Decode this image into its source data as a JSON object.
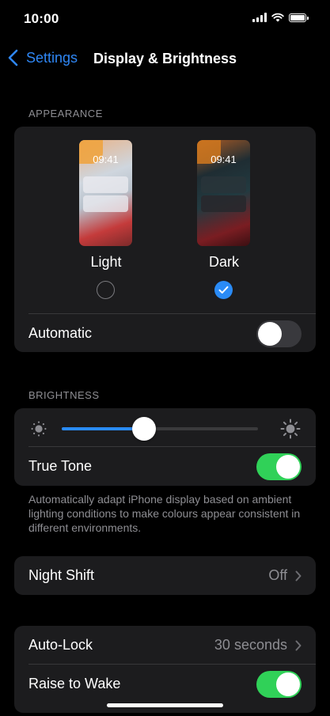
{
  "status_bar": {
    "time": "10:00"
  },
  "nav": {
    "back_label": "Settings",
    "title": "Display & Brightness"
  },
  "appearance": {
    "section_label": "APPEARANCE",
    "light": {
      "preview_time": "09:41",
      "label": "Light",
      "selected": false
    },
    "dark": {
      "preview_time": "09:41",
      "label": "Dark",
      "selected": true
    },
    "automatic": {
      "label": "Automatic",
      "on": false
    }
  },
  "brightness": {
    "section_label": "BRIGHTNESS",
    "level": 0.42,
    "true_tone": {
      "label": "True Tone",
      "on": true
    },
    "footnote": "Automatically adapt iPhone display based on ambient lighting conditions to make colours appear consistent in different environments."
  },
  "night_shift": {
    "label": "Night Shift",
    "value": "Off"
  },
  "auto_lock": {
    "label": "Auto-Lock",
    "value": "30 seconds"
  },
  "raise_to_wake": {
    "label": "Raise to Wake",
    "on": true
  },
  "colors": {
    "accent": "#2a8bf6",
    "toggle_on": "#30d158",
    "group_bg": "#1c1c1e"
  }
}
